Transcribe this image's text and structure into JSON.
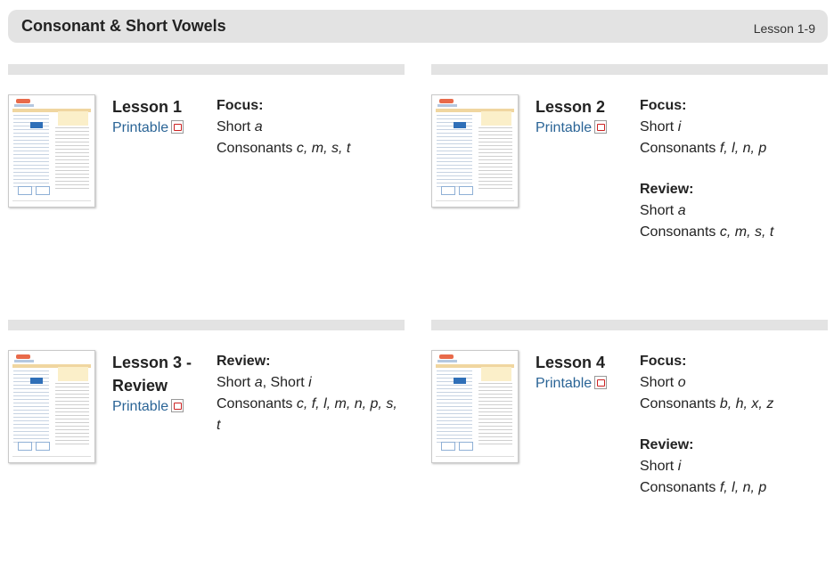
{
  "header": {
    "title": "Consonant & Short Vowels",
    "range": "Lesson 1-9"
  },
  "lessons": [
    {
      "title": "Lesson 1",
      "printable": "Printable",
      "sections": [
        {
          "label": "Focus:",
          "lines": [
            [
              "Short ",
              "a"
            ],
            [
              "Consonants ",
              "c, m, s, t"
            ]
          ]
        }
      ]
    },
    {
      "title": "Lesson 2",
      "printable": "Printable",
      "sections": [
        {
          "label": "Focus:",
          "lines": [
            [
              "Short ",
              "i"
            ],
            [
              "Consonants ",
              "f, l, n, p"
            ]
          ]
        },
        {
          "label": "Review:",
          "lines": [
            [
              "Short ",
              "a"
            ],
            [
              "Consonants ",
              "c, m, s, t"
            ]
          ]
        }
      ]
    },
    {
      "title": "Lesson 3 - Review",
      "printable": "Printable",
      "sections": [
        {
          "label": "Review:",
          "lines": [
            [
              "Short ",
              "a",
              ", Short ",
              "i"
            ],
            [
              "Consonants ",
              "c, f, l, m, n, p, s, t"
            ]
          ]
        }
      ]
    },
    {
      "title": "Lesson 4",
      "printable": "Printable",
      "sections": [
        {
          "label": "Focus:",
          "lines": [
            [
              "Short ",
              "o"
            ],
            [
              "Consonants ",
              "b, h, x, z"
            ]
          ]
        },
        {
          "label": "Review:",
          "lines": [
            [
              "Short ",
              "i"
            ],
            [
              "Consonants ",
              "f, l, n, p"
            ]
          ]
        }
      ]
    }
  ]
}
